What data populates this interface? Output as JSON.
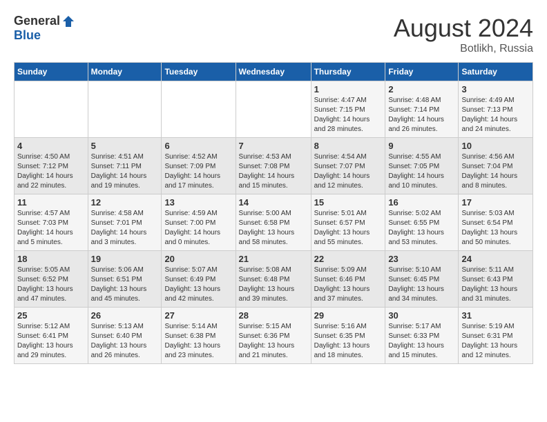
{
  "header": {
    "logo_general": "General",
    "logo_blue": "Blue",
    "month_year": "August 2024",
    "location": "Botlikh, Russia"
  },
  "days_of_week": [
    "Sunday",
    "Monday",
    "Tuesday",
    "Wednesday",
    "Thursday",
    "Friday",
    "Saturday"
  ],
  "weeks": [
    {
      "days": [
        {
          "number": "",
          "info": ""
        },
        {
          "number": "",
          "info": ""
        },
        {
          "number": "",
          "info": ""
        },
        {
          "number": "",
          "info": ""
        },
        {
          "number": "1",
          "info": "Sunrise: 4:47 AM\nSunset: 7:15 PM\nDaylight: 14 hours\nand 28 minutes."
        },
        {
          "number": "2",
          "info": "Sunrise: 4:48 AM\nSunset: 7:14 PM\nDaylight: 14 hours\nand 26 minutes."
        },
        {
          "number": "3",
          "info": "Sunrise: 4:49 AM\nSunset: 7:13 PM\nDaylight: 14 hours\nand 24 minutes."
        }
      ]
    },
    {
      "days": [
        {
          "number": "4",
          "info": "Sunrise: 4:50 AM\nSunset: 7:12 PM\nDaylight: 14 hours\nand 22 minutes."
        },
        {
          "number": "5",
          "info": "Sunrise: 4:51 AM\nSunset: 7:11 PM\nDaylight: 14 hours\nand 19 minutes."
        },
        {
          "number": "6",
          "info": "Sunrise: 4:52 AM\nSunset: 7:09 PM\nDaylight: 14 hours\nand 17 minutes."
        },
        {
          "number": "7",
          "info": "Sunrise: 4:53 AM\nSunset: 7:08 PM\nDaylight: 14 hours\nand 15 minutes."
        },
        {
          "number": "8",
          "info": "Sunrise: 4:54 AM\nSunset: 7:07 PM\nDaylight: 14 hours\nand 12 minutes."
        },
        {
          "number": "9",
          "info": "Sunrise: 4:55 AM\nSunset: 7:05 PM\nDaylight: 14 hours\nand 10 minutes."
        },
        {
          "number": "10",
          "info": "Sunrise: 4:56 AM\nSunset: 7:04 PM\nDaylight: 14 hours\nand 8 minutes."
        }
      ]
    },
    {
      "days": [
        {
          "number": "11",
          "info": "Sunrise: 4:57 AM\nSunset: 7:03 PM\nDaylight: 14 hours\nand 5 minutes."
        },
        {
          "number": "12",
          "info": "Sunrise: 4:58 AM\nSunset: 7:01 PM\nDaylight: 14 hours\nand 3 minutes."
        },
        {
          "number": "13",
          "info": "Sunrise: 4:59 AM\nSunset: 7:00 PM\nDaylight: 14 hours\nand 0 minutes."
        },
        {
          "number": "14",
          "info": "Sunrise: 5:00 AM\nSunset: 6:58 PM\nDaylight: 13 hours\nand 58 minutes."
        },
        {
          "number": "15",
          "info": "Sunrise: 5:01 AM\nSunset: 6:57 PM\nDaylight: 13 hours\nand 55 minutes."
        },
        {
          "number": "16",
          "info": "Sunrise: 5:02 AM\nSunset: 6:55 PM\nDaylight: 13 hours\nand 53 minutes."
        },
        {
          "number": "17",
          "info": "Sunrise: 5:03 AM\nSunset: 6:54 PM\nDaylight: 13 hours\nand 50 minutes."
        }
      ]
    },
    {
      "days": [
        {
          "number": "18",
          "info": "Sunrise: 5:05 AM\nSunset: 6:52 PM\nDaylight: 13 hours\nand 47 minutes."
        },
        {
          "number": "19",
          "info": "Sunrise: 5:06 AM\nSunset: 6:51 PM\nDaylight: 13 hours\nand 45 minutes."
        },
        {
          "number": "20",
          "info": "Sunrise: 5:07 AM\nSunset: 6:49 PM\nDaylight: 13 hours\nand 42 minutes."
        },
        {
          "number": "21",
          "info": "Sunrise: 5:08 AM\nSunset: 6:48 PM\nDaylight: 13 hours\nand 39 minutes."
        },
        {
          "number": "22",
          "info": "Sunrise: 5:09 AM\nSunset: 6:46 PM\nDaylight: 13 hours\nand 37 minutes."
        },
        {
          "number": "23",
          "info": "Sunrise: 5:10 AM\nSunset: 6:45 PM\nDaylight: 13 hours\nand 34 minutes."
        },
        {
          "number": "24",
          "info": "Sunrise: 5:11 AM\nSunset: 6:43 PM\nDaylight: 13 hours\nand 31 minutes."
        }
      ]
    },
    {
      "days": [
        {
          "number": "25",
          "info": "Sunrise: 5:12 AM\nSunset: 6:41 PM\nDaylight: 13 hours\nand 29 minutes."
        },
        {
          "number": "26",
          "info": "Sunrise: 5:13 AM\nSunset: 6:40 PM\nDaylight: 13 hours\nand 26 minutes."
        },
        {
          "number": "27",
          "info": "Sunrise: 5:14 AM\nSunset: 6:38 PM\nDaylight: 13 hours\nand 23 minutes."
        },
        {
          "number": "28",
          "info": "Sunrise: 5:15 AM\nSunset: 6:36 PM\nDaylight: 13 hours\nand 21 minutes."
        },
        {
          "number": "29",
          "info": "Sunrise: 5:16 AM\nSunset: 6:35 PM\nDaylight: 13 hours\nand 18 minutes."
        },
        {
          "number": "30",
          "info": "Sunrise: 5:17 AM\nSunset: 6:33 PM\nDaylight: 13 hours\nand 15 minutes."
        },
        {
          "number": "31",
          "info": "Sunrise: 5:19 AM\nSunset: 6:31 PM\nDaylight: 13 hours\nand 12 minutes."
        }
      ]
    }
  ]
}
